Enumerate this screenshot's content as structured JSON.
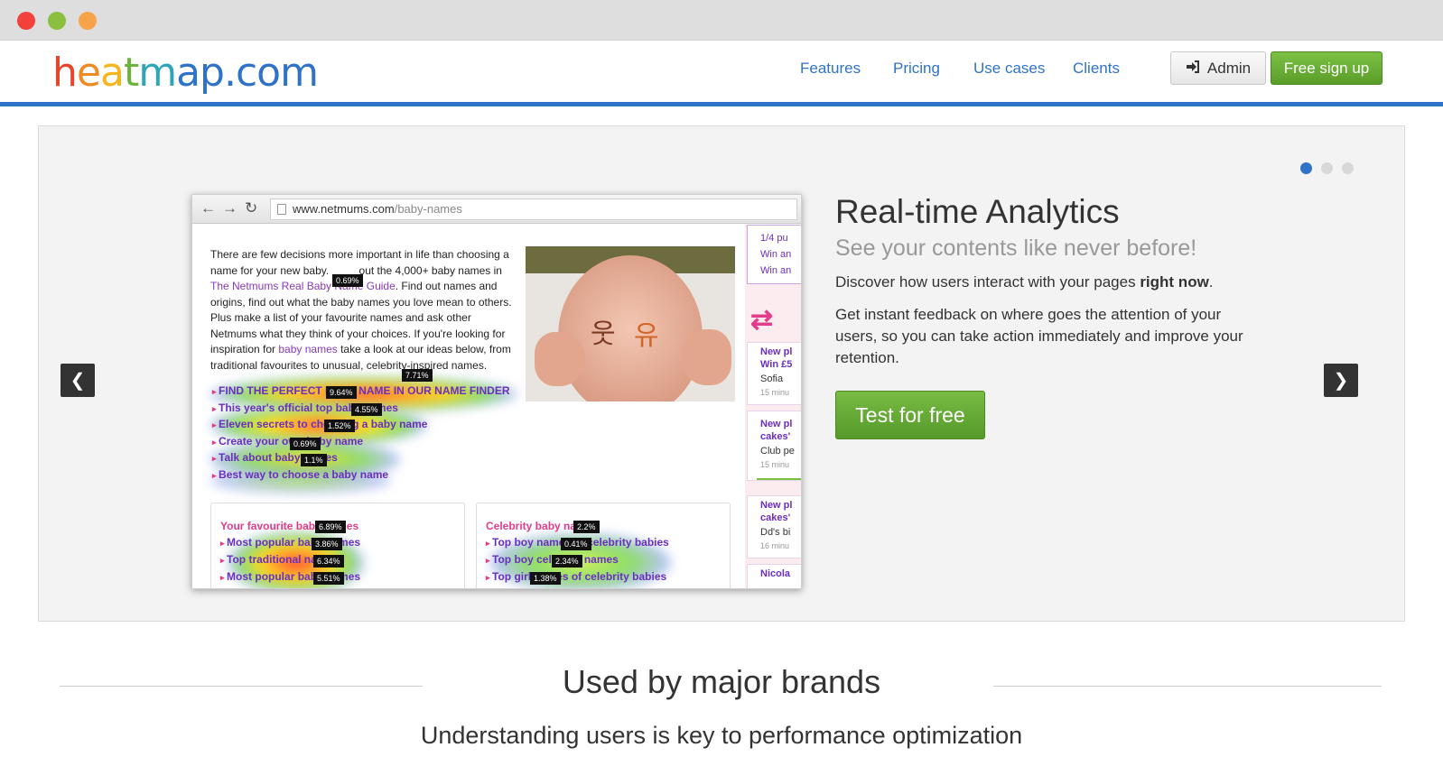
{
  "window": {
    "controls": [
      "close",
      "minimize",
      "maximize"
    ]
  },
  "header": {
    "logo_letters": [
      {
        "ch": "h",
        "color": "#e8452a"
      },
      {
        "ch": "e",
        "color": "#f08a22"
      },
      {
        "ch": "a",
        "color": "#f5b51e"
      },
      {
        "ch": "t",
        "color": "#6bb43a"
      },
      {
        "ch": "m",
        "color": "#2fa6b8"
      },
      {
        "ch": "a",
        "color": "#2f73c9"
      },
      {
        "ch": "p",
        "color": "#2f73c9"
      },
      {
        "ch": ".com",
        "color": "#2f73c9"
      }
    ],
    "nav": [
      "Features",
      "Pricing",
      "Use cases",
      "Clients"
    ],
    "admin_label": "Admin",
    "admin_icon": "sign-in-icon",
    "signup_label": "Free sign up"
  },
  "colors": {
    "brand_blue": "#2f73c9",
    "cta_green": "#6aaf37",
    "dark": "#333333"
  },
  "carousel": {
    "dots": 3,
    "active_dot": 0,
    "prev_label": "❮",
    "next_label": "❯",
    "slide": {
      "title": "Real-time Analytics",
      "subtitle": "See your contents like never before!",
      "p1_text": "Discover how users interact with your pages ",
      "p1_bold": "right now",
      "p1_end": ".",
      "p2": "Get instant feedback on where goes the attention of your users, so you can take action immediately and improve your retention.",
      "cta": "Test for free"
    },
    "screenshot": {
      "url_host": "www.netmums.com",
      "url_path": "/baby-names",
      "intro_1": "There are few decisions more important in life than choosing a name for your new baby. ",
      "intro_2": "out the 4,000+ baby names in ",
      "intro_link1": "The Netmums Real Baby Name Guide",
      "intro_3": ". Find out names and origins, find out what the baby names you love mean to others. Plus make a list of your favourite names and ask other Netmums what they think of your choices. If you're looking for inspiration for ",
      "intro_link2": "baby names",
      "intro_4": " take a look at our ideas below, from traditional favourites to unusual, celebrity-inspired names.",
      "list": [
        "FIND THE PERFECT BABY NAME IN OUR NAME FINDER",
        "This year's official top baby names",
        "Eleven secrets to choosing a baby name",
        "Create your own baby name",
        "Talk about baby names",
        "Best way to choose a baby name"
      ],
      "badges": [
        "0.69%",
        "7.71%",
        "9.64%",
        "4.55%",
        "1.52%",
        "0.69%",
        "1.1%",
        "6.89%",
        "3.86%",
        "6.34%",
        "5.51%",
        "2.2%",
        "0.41%",
        "2.34%",
        "1.38%"
      ],
      "box_left": {
        "title": "Your favourite baby names",
        "items": [
          "Most popular baby names",
          "Top traditional names",
          "Most popular baby names"
        ]
      },
      "box_right": {
        "title": "Celebrity baby names",
        "items": [
          "Top boy names of celebrity babies",
          "Top boy celebrity names",
          "Top girl names of celebrity babies"
        ]
      },
      "side": {
        "top_lines": [
          "1/4 pu",
          "Win an",
          "Win an"
        ],
        "cards": [
          {
            "t1": "New pl",
            "t2": "Win £5",
            "s": "Sofia",
            "m": "15 minu"
          },
          {
            "t1": "New pl",
            "t2": "cakes'",
            "s": "Club pe",
            "m": "15 minu"
          },
          {
            "t1": "New pl",
            "t2": "cakes'",
            "s": "Dd's bi",
            "m": "16 minu"
          },
          {
            "t1": "Nicola",
            "t2": "",
            "s": "",
            "m": ""
          }
        ]
      }
    }
  },
  "brands": {
    "title": "Used by major brands",
    "subtitle": "Understanding users is key to performance optimization"
  }
}
